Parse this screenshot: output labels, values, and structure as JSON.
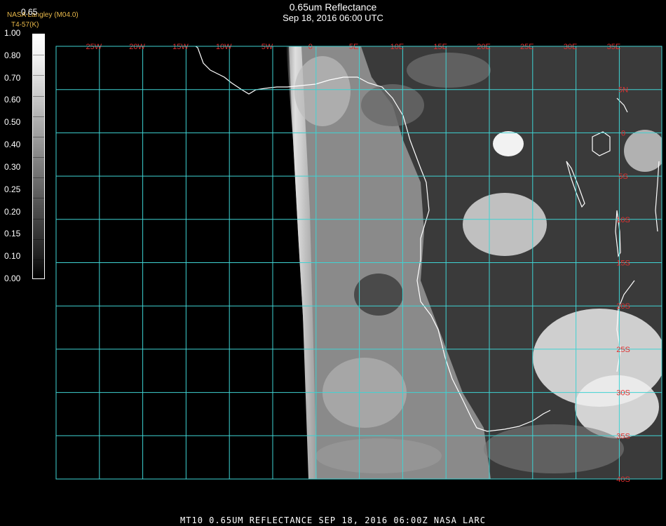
{
  "header": {
    "title": "0.65um Reflectance",
    "subtitle": "Sep 18, 2016 06:00 UTC",
    "credit": "NASA Langley (M04.0)",
    "credit2": "T4-57(K)"
  },
  "colorbar": {
    "top_value": "0.65",
    "labels": [
      "1.00",
      "0.80",
      "0.70",
      "0.60",
      "0.50",
      "0.40",
      "0.30",
      "0.25",
      "0.20",
      "0.15",
      "0.10",
      "0.00"
    ]
  },
  "grid": {
    "lon_labels": [
      "25W",
      "20W",
      "15W",
      "10W",
      "5W",
      "0",
      "5E",
      "10E",
      "15E",
      "20E",
      "25E",
      "30E",
      "35E"
    ],
    "lat_labels": [
      "5N",
      "0",
      "5S",
      "10S",
      "15S",
      "20S",
      "25S",
      "30S",
      "35S",
      "40S"
    ],
    "line_color": "#3fd3d3",
    "label_color": "#e03030"
  },
  "footer": {
    "caption": "MT10  0.65UM REFLECTANCE   SEP 18, 2016 06:00Z   NASA LARC"
  }
}
